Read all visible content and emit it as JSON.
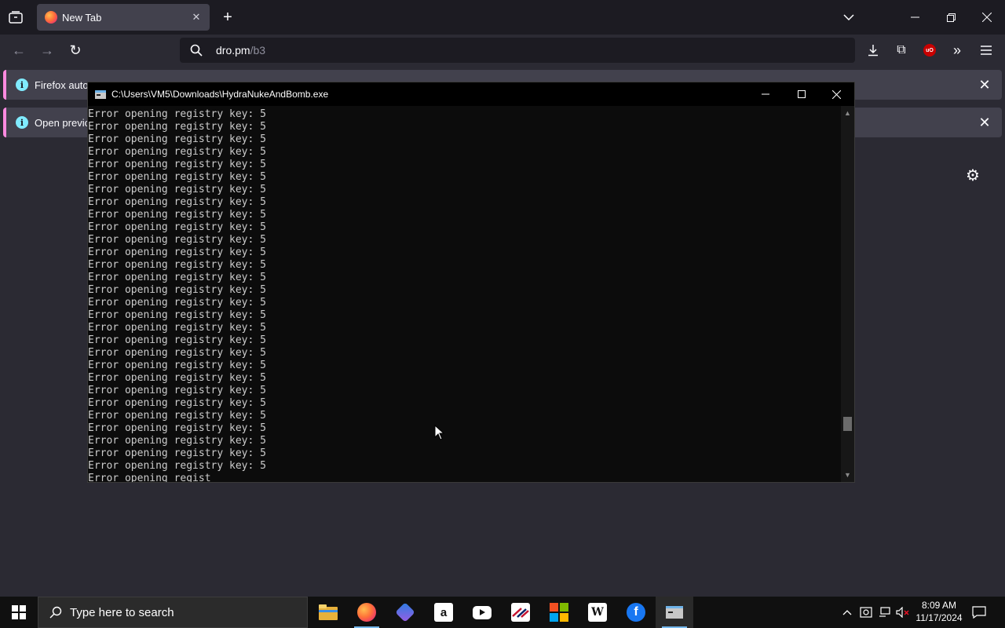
{
  "browser": {
    "tab": {
      "title": "New Tab"
    },
    "url": {
      "host": "dro.pm",
      "path": "/b3"
    },
    "notifications": [
      {
        "text": "Firefox autom"
      },
      {
        "text": "Open previou"
      }
    ]
  },
  "console": {
    "title": "C:\\Users\\VM5\\Downloads\\HydraNukeAndBomb.exe",
    "lines": [
      "Error opening registry key: 5",
      "Error opening registry key: 5",
      "Error opening registry key: 5",
      "Error opening registry key: 5",
      "Error opening registry key: 5",
      "Error opening registry key: 5",
      "Error opening registry key: 5",
      "Error opening registry key: 5",
      "Error opening registry key: 5",
      "Error opening registry key: 5",
      "Error opening registry key: 5",
      "Error opening registry key: 5",
      "Error opening registry key: 5",
      "Error opening registry key: 5",
      "Error opening registry key: 5",
      "Error opening registry key: 5",
      "Error opening registry key: 5",
      "Error opening registry key: 5",
      "Error opening registry key: 5",
      "Error opening registry key: 5",
      "Error opening registry key: 5",
      "Error opening registry key: 5",
      "Error opening registry key: 5",
      "Error opening registry key: 5",
      "Error opening registry key: 5",
      "Error opening registry key: 5",
      "Error opening registry key: 5",
      "Error opening registry key: 5",
      "Error opening registry key: 5",
      "Error opening regist"
    ]
  },
  "taskbar": {
    "search_placeholder": "Type here to search",
    "apps": [
      "file-explorer",
      "firefox",
      "copilot",
      "amazon",
      "youtube",
      "bank-of-america",
      "microsoft-store",
      "wikipedia",
      "facebook",
      "console"
    ],
    "clock": {
      "time": "8:09 AM",
      "date": "11/17/2024"
    }
  }
}
